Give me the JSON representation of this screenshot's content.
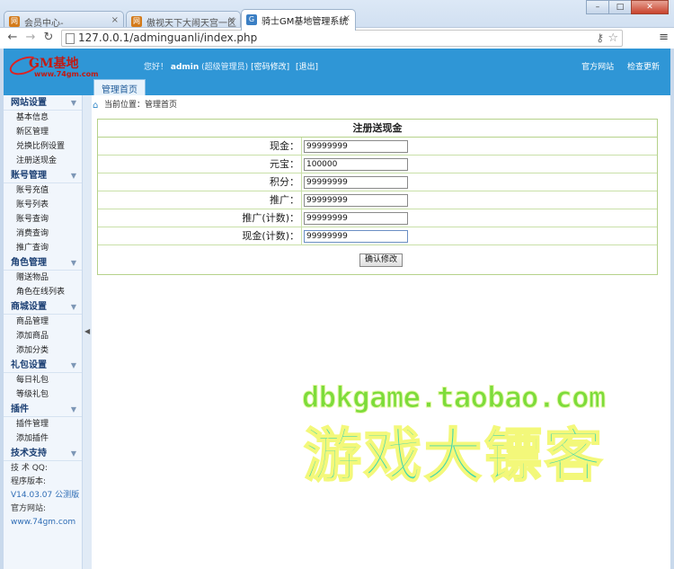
{
  "browser": {
    "tabs": [
      {
        "title": "会员中心-",
        "icon": "site-favicon-orange"
      },
      {
        "title": "傲视天下大闹天宫一区",
        "icon": "site-favicon-orange"
      },
      {
        "title": "骑士GM基地管理系统",
        "icon": "site-favicon-blue"
      }
    ],
    "close_glyph": "×",
    "url": "127.0.0.1/adminguanli/index.php"
  },
  "header": {
    "logo_text": "GM基地",
    "logo_sub": "www.74gm.com",
    "greeting": "您好！",
    "user": "admin",
    "role": "(超级管理员)",
    "change_password": "[密码修改]",
    "logout": "[退出]",
    "official_site": "官方网站",
    "refresh": "检查更新",
    "main_tab": "管理首页"
  },
  "sidebar": {
    "groups": [
      {
        "title": "网站设置",
        "items": [
          "基本信息",
          "新区管理",
          "兑换比例设置",
          "注册送现金"
        ]
      },
      {
        "title": "账号管理",
        "items": [
          "账号充值",
          "账号列表",
          "账号查询",
          "消费查询",
          "推广查询"
        ]
      },
      {
        "title": "角色管理",
        "items": [
          "赠送物品",
          "角色在线列表"
        ]
      },
      {
        "title": "商城设置",
        "items": [
          "商品管理",
          "添加商品",
          "添加分类"
        ]
      },
      {
        "title": "礼包设置",
        "items": [
          "每日礼包",
          "等级礼包"
        ]
      },
      {
        "title": "插件",
        "items": [
          "插件管理",
          "添加插件"
        ]
      },
      {
        "title": "技术支持",
        "items": []
      }
    ],
    "footer": {
      "qq": "技 术 QQ:",
      "version_label": "程序版本:",
      "version": "V14.03.07 公测版",
      "site_label": "官方网站:",
      "site": "www.74gm.com"
    }
  },
  "breadcrumb": {
    "label": "当前位置：",
    "current": "管理首页"
  },
  "form": {
    "title": "注册送现金",
    "fields": [
      {
        "label": "现金：",
        "value": "99999999"
      },
      {
        "label": "元宝：",
        "value": "100000"
      },
      {
        "label": "积分：",
        "value": "99999999"
      },
      {
        "label": "推广：",
        "value": "99999999"
      },
      {
        "label": "推广(计数)：",
        "value": "99999999"
      },
      {
        "label": "现金(计数)：",
        "value": "99999999"
      }
    ],
    "submit": "确认修改"
  },
  "watermark": {
    "url": "dbkgame.taobao.com",
    "text": "游戏大镖客"
  }
}
